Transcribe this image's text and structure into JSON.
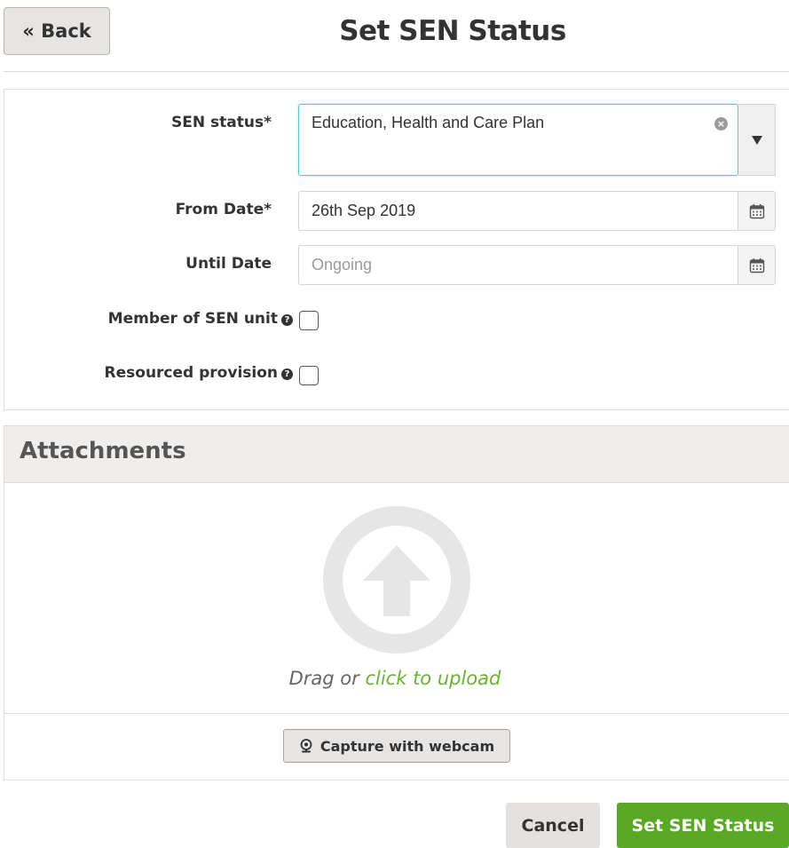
{
  "header": {
    "back_label": "« Back",
    "title": "Set SEN Status"
  },
  "form": {
    "sen_status": {
      "label": "SEN status*",
      "value": "Education, Health and Care Plan"
    },
    "from_date": {
      "label": "From Date*",
      "value": "26th Sep 2019"
    },
    "until_date": {
      "label": "Until Date",
      "placeholder": "Ongoing"
    },
    "member_sen_unit": {
      "label": "Member of SEN unit",
      "checked": false
    },
    "resourced_provision": {
      "label": "Resourced provision",
      "checked": false
    }
  },
  "attachments": {
    "title": "Attachments",
    "drag_text": "Drag or ",
    "upload_link": "click to upload",
    "webcam_label": "Capture with webcam"
  },
  "footer": {
    "cancel_label": "Cancel",
    "submit_label": "Set SEN Status"
  },
  "colors": {
    "accent_green": "#5aa926",
    "link_green": "#6bb233",
    "focus_teal": "#5bc5cf",
    "header_bg": "#efeeec"
  },
  "icons": {
    "clear": "clear-icon",
    "dropdown": "caret-down-icon",
    "calendar": "calendar-icon",
    "help": "help-icon",
    "upload": "upload-arrow-icon",
    "webcam": "webcam-icon"
  }
}
